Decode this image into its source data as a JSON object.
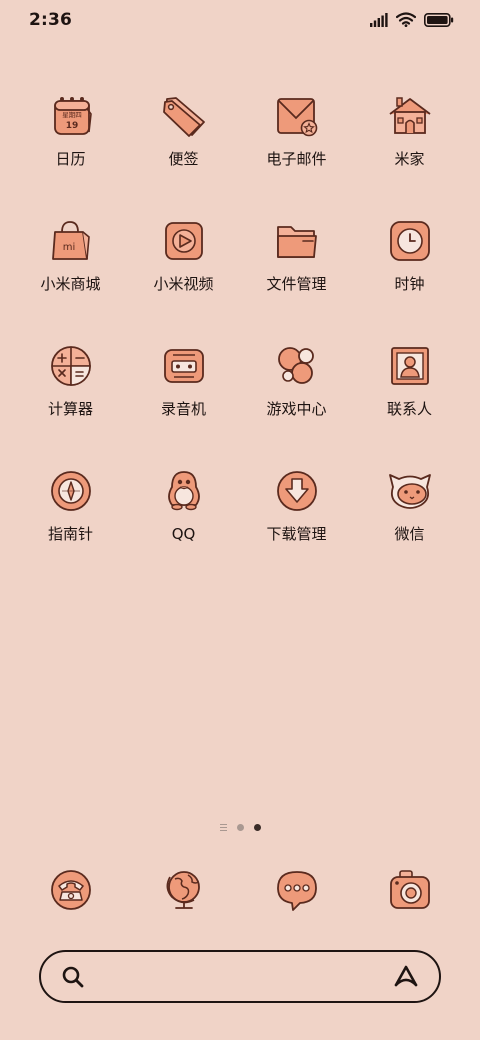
{
  "status_bar": {
    "time": "2:36",
    "battery_level": 1.0
  },
  "colors": {
    "background": "#F0D3C7",
    "icon_fill": "#EE9A7A",
    "icon_outline": "#5A2A1E",
    "text": "#1E1412"
  },
  "apps": [
    {
      "label": "日历",
      "icon": "calendar-icon",
      "badge_weekday": "星期四",
      "badge_day": "19"
    },
    {
      "label": "便签",
      "icon": "notes-tag-icon"
    },
    {
      "label": "电子邮件",
      "icon": "mail-icon"
    },
    {
      "label": "米家",
      "icon": "home-icon"
    },
    {
      "label": "小米商城",
      "icon": "shopping-bag-icon",
      "badge_text": "mi"
    },
    {
      "label": "小米视频",
      "icon": "video-play-icon"
    },
    {
      "label": "文件管理",
      "icon": "folder-icon"
    },
    {
      "label": "时钟",
      "icon": "clock-icon"
    },
    {
      "label": "计算器",
      "icon": "calculator-icon"
    },
    {
      "label": "录音机",
      "icon": "recorder-icon"
    },
    {
      "label": "游戏中心",
      "icon": "game-center-icon"
    },
    {
      "label": "联系人",
      "icon": "contact-icon"
    },
    {
      "label": "指南针",
      "icon": "compass-icon"
    },
    {
      "label": "QQ",
      "icon": "qq-penguin-icon"
    },
    {
      "label": "下载管理",
      "icon": "download-icon"
    },
    {
      "label": "微信",
      "icon": "wechat-icon"
    }
  ],
  "pager": {
    "pages": 3,
    "active_index": 2
  },
  "dock": [
    {
      "icon": "phone-icon"
    },
    {
      "icon": "browser-globe-icon"
    },
    {
      "icon": "messages-icon"
    },
    {
      "icon": "camera-icon"
    }
  ],
  "search": {
    "placeholder": "",
    "left_icon": "search-icon",
    "right_icon": "assistant-icon"
  }
}
